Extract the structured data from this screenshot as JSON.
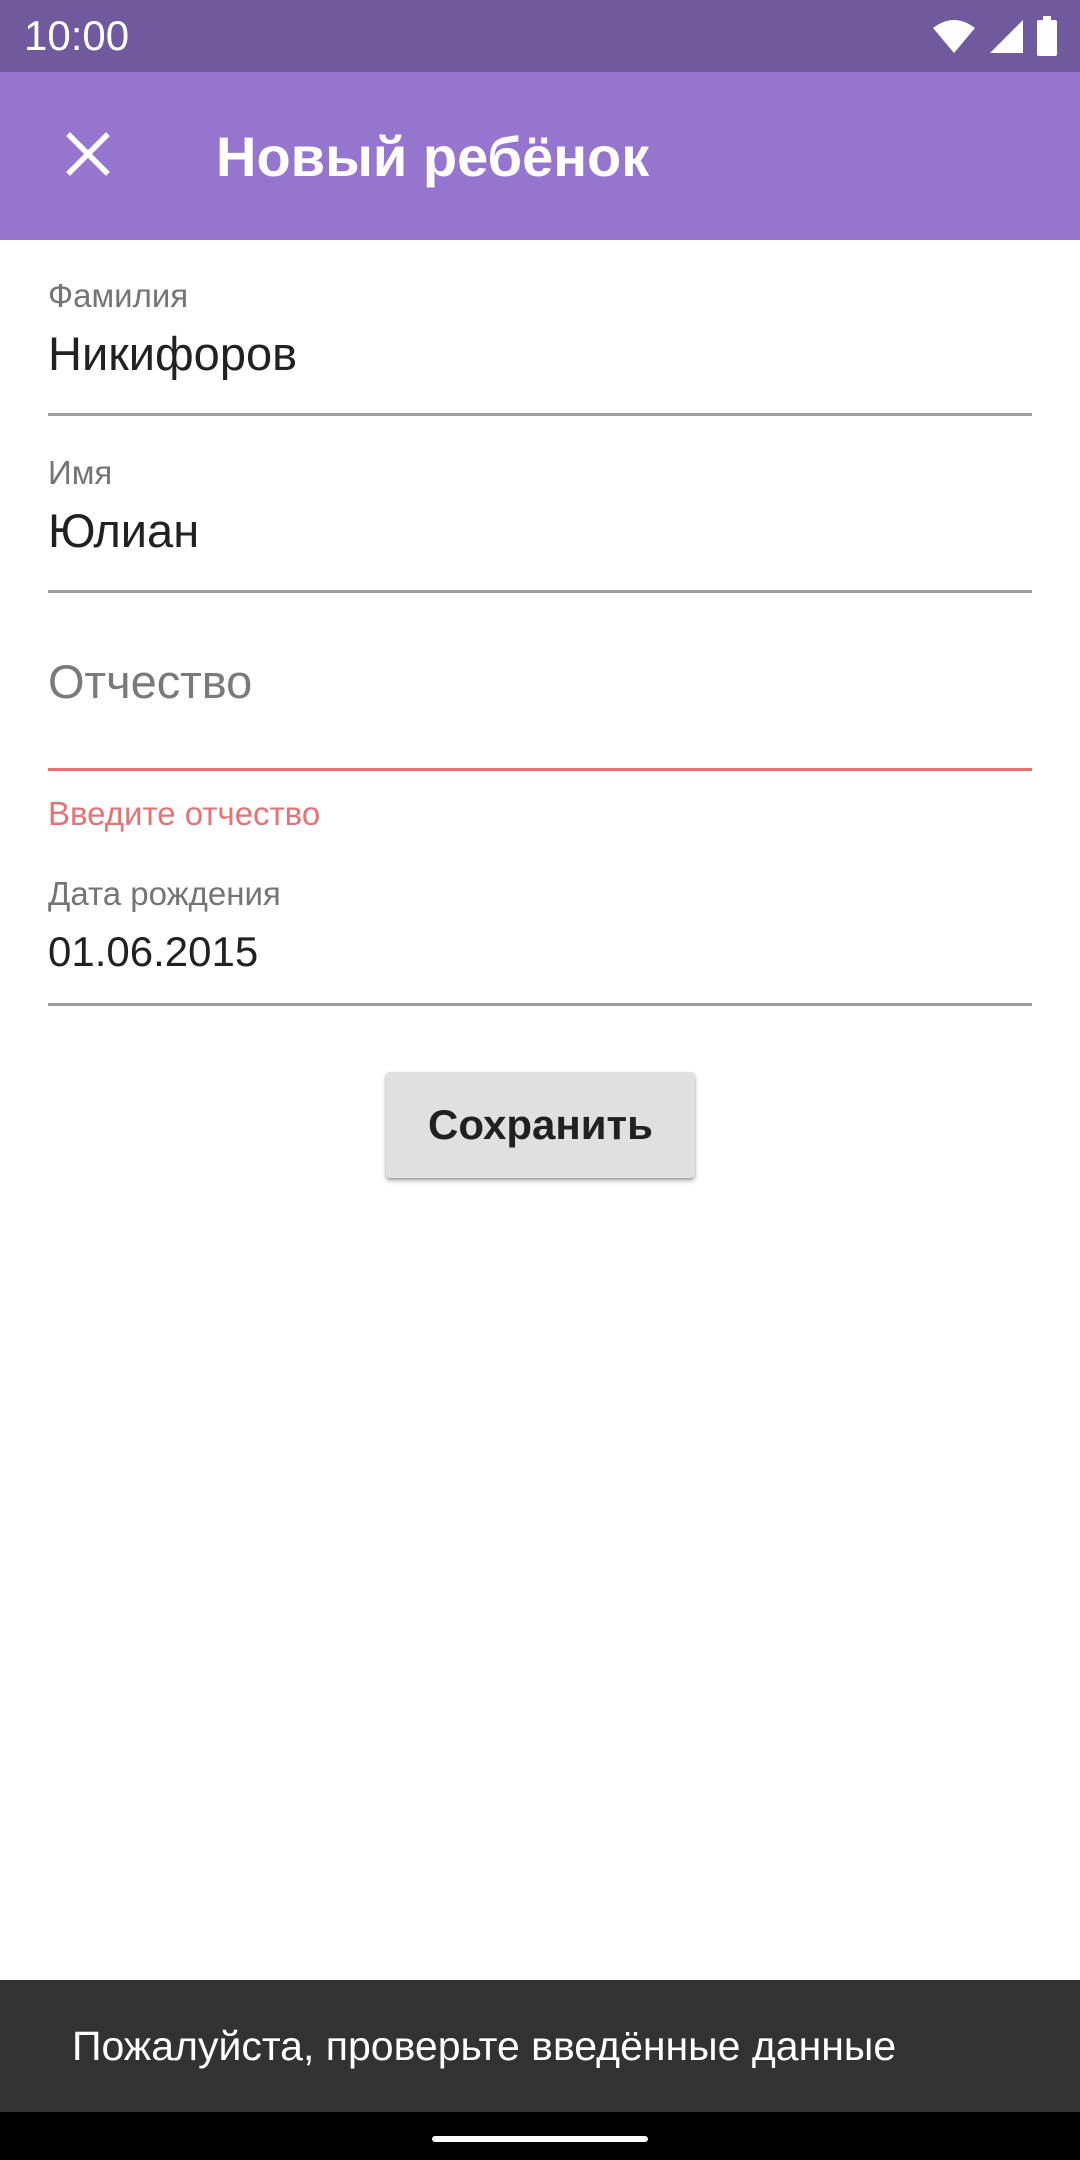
{
  "status_bar": {
    "time": "10:00",
    "icons": [
      "wifi-icon",
      "signal-icon",
      "battery-icon"
    ]
  },
  "app_bar": {
    "close_icon": "close-icon",
    "title": "Новый ребёнок",
    "background": "#9575cd"
  },
  "form": {
    "last_name": {
      "label": "Фамилия",
      "value": "Никифоров"
    },
    "first_name": {
      "label": "Имя",
      "value": "Юлиан"
    },
    "patronymic": {
      "placeholder": "Отчество",
      "value": "",
      "error": "Введите отчество"
    },
    "birth_date": {
      "label": "Дата рождения",
      "value": "01.06.2015"
    }
  },
  "actions": {
    "save_label": "Сохранить"
  },
  "snackbar": {
    "message": "Пожалуйста, проверьте введённые данные"
  },
  "colors": {
    "status_bar": "#6f5a9e",
    "accent": "#9575cd",
    "error": "#e57373",
    "snackbar": "#323232"
  }
}
